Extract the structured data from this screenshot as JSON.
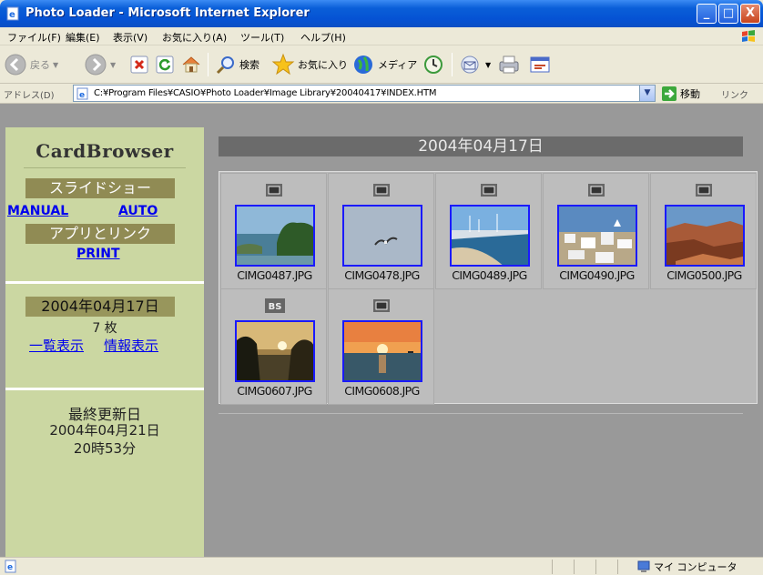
{
  "window": {
    "title": "Photo Loader - Microsoft Internet Explorer",
    "controls": [
      "_",
      "□",
      "X"
    ]
  },
  "menu": [
    "ファイル(F)",
    "編集(E)",
    "表示(V)",
    "お気に入り(A)",
    "ツール(T)",
    "ヘルプ(H)"
  ],
  "toolbar": {
    "back": "戻る",
    "search": "検索",
    "favorites": "お気に入り",
    "media": "メディア"
  },
  "address": {
    "label": "アドレス(D)",
    "url": "C:¥Program Files¥CASIO¥Photo Loader¥Image Library¥20040417¥INDEX.HTM",
    "go": "移動",
    "links": "リンク"
  },
  "sidebar": {
    "brand": "CardBrowser",
    "slideshow": "スライドショー",
    "manual": "MANUAL",
    "auto": "AUTO",
    "app_link": "アプリとリンク",
    "print": "PRINT",
    "date": "2004年04月17日",
    "count": "7 枚",
    "list_view": "一覧表示",
    "info_view": "情報表示",
    "last_updated_label": "最終更新日",
    "last_updated_date": "2004年04月21日",
    "last_updated_time": "20時53分"
  },
  "main": {
    "date_header": "2004年04月17日",
    "photos": [
      {
        "file": "CIMG0487.JPG",
        "badge": "normal",
        "scene": "coast-island"
      },
      {
        "file": "CIMG0478.JPG",
        "badge": "normal",
        "scene": "seagull-sky"
      },
      {
        "file": "CIMG0489.JPG",
        "badge": "normal",
        "scene": "harbor"
      },
      {
        "file": "CIMG0490.JPG",
        "badge": "normal",
        "scene": "white-village"
      },
      {
        "file": "CIMG0500.JPG",
        "badge": "normal",
        "scene": "canyon"
      },
      {
        "file": "CIMG0607.JPG",
        "badge": "BS",
        "scene": "rocky-sunset"
      },
      {
        "file": "CIMG0608.JPG",
        "badge": "normal",
        "scene": "sea-sunset"
      }
    ]
  },
  "status": {
    "zone": "マイ コンピュータ"
  },
  "colors": {
    "titlebar": "#0552d4",
    "sidebar": "#cbd7a2",
    "olive_label": "#908b54",
    "content_bg": "#999999",
    "link": "#0000ee",
    "thumb_border": "#1a1aff"
  }
}
